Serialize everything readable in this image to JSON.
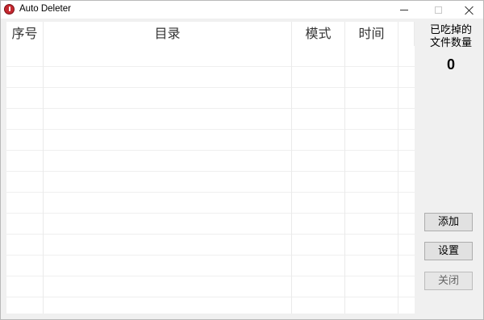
{
  "window": {
    "title": "Auto Deleter",
    "app_icon": "app-icon-red-circle"
  },
  "title_controls": {
    "minimize_icon": "minimize-icon",
    "maximize_icon": "maximize-icon",
    "close_icon": "close-icon"
  },
  "table": {
    "columns": [
      "序号",
      "目录",
      "模式",
      "时间"
    ],
    "rows": []
  },
  "stats": {
    "label_line1": "已吃掉的",
    "label_line2": "文件数量",
    "count": "0"
  },
  "buttons": {
    "add": "添加",
    "settings": "设置",
    "third": "关闭"
  },
  "colors": {
    "window_bg": "#f0f0f0",
    "grid_bg": "#ffffff",
    "button_bg": "#e1e1e1",
    "app_icon": "#c5282f"
  }
}
